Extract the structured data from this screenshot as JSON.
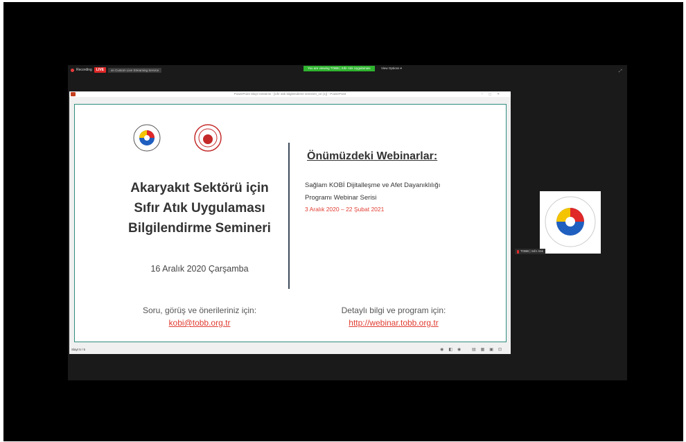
{
  "zoom": {
    "recording_label": "Recording",
    "live_label": "LIVE",
    "stream_label": "on Custom Live Streaming Service",
    "viewing_label": "You are viewing TOBB | Sıfır Atık Uygulaması",
    "view_options_label": "View Options ▾",
    "participant_name": "TOBB | Sıfır Atık"
  },
  "powerpoint": {
    "window_title": "PowerPoint Slayt Gösterisi - [sıfır atık bilgilendirme semineri_v2 (1)] - PowerPoint",
    "slide_number": "Slayt 5 / 5"
  },
  "slide": {
    "title_lines": [
      "Akaryakıt Sektörü için",
      "Sıfır Atık Uygulaması",
      "Bilgilendirme Semineri"
    ],
    "date": "16 Aralık 2020 Çarşamba",
    "right_heading": "Önümüzdeki Webinarlar:",
    "right_text_1": "Sağlam KOBİ Dijitalleşme ve Afet Dayanıklılığı",
    "right_text_2": "Programı Webinar Serisi",
    "right_dates": "3 Aralık 2020 – 22 Şubat 2021",
    "contact_left": "Soru, görüş ve önerileriniz için:",
    "email": "kobi@tobb.org.tr",
    "contact_right": "Detaylı bilgi ve program için:",
    "url": "http://webinar.tobb.org.tr"
  },
  "colors": {
    "accent_red": "#e03c31",
    "zoom_green": "#2fb42f",
    "border_teal": "#2e8b7b"
  }
}
